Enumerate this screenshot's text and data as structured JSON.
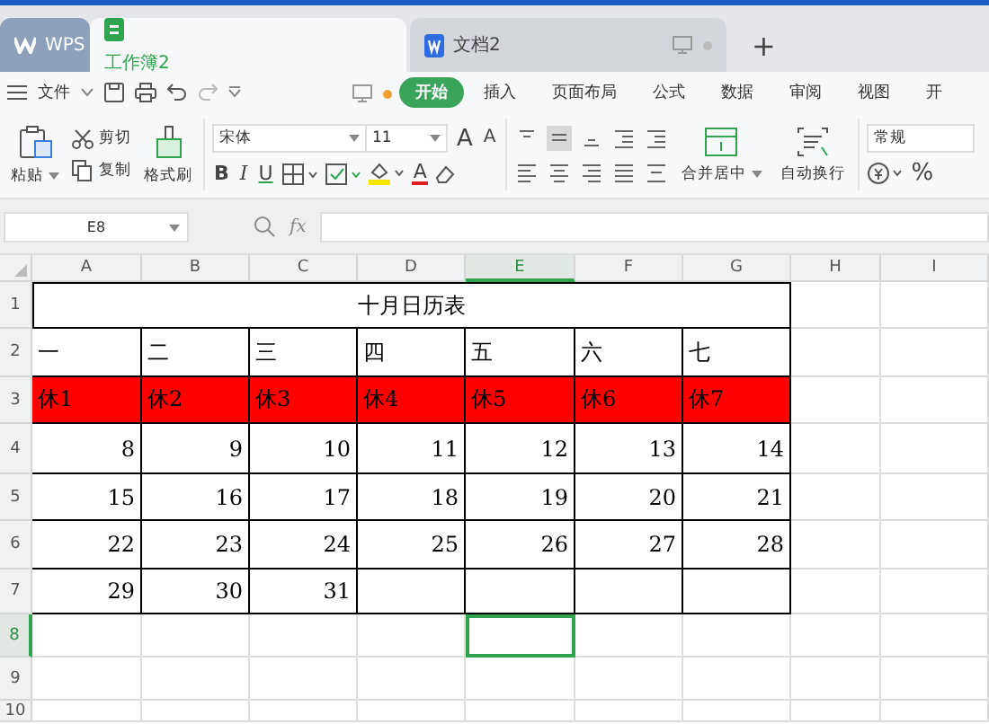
{
  "window_tabs": [
    {
      "label": "WPS",
      "kind": "home",
      "selected": false
    },
    {
      "label": "工作簿2",
      "kind": "sheet",
      "selected": true
    },
    {
      "label": "文档2",
      "kind": "doc",
      "selected": false
    }
  ],
  "new_tab": "+",
  "menu": {
    "label": "文件"
  },
  "ribbon_tabs": [
    {
      "label": "开始",
      "selected": true
    },
    {
      "label": "插入",
      "selected": false
    },
    {
      "label": "页面布局",
      "selected": false
    },
    {
      "label": "公式",
      "selected": false
    },
    {
      "label": "数据",
      "selected": false
    },
    {
      "label": "审阅",
      "selected": false
    },
    {
      "label": "视图",
      "selected": false
    },
    {
      "label": "开",
      "selected": false
    }
  ],
  "clipboard": {
    "paste": "粘贴",
    "cut": "剪切",
    "copy": "复制",
    "format_painter": "格式刷"
  },
  "font": {
    "name": "宋体",
    "size": "11",
    "grow": "A",
    "shrink": "A",
    "bold": "B",
    "italic": "I",
    "underline": "U",
    "font_color": "A"
  },
  "merge": "合并居中",
  "wrap": "自动换行",
  "number_format": "常规",
  "percent": "%",
  "name_box": "E8",
  "fx": "fx",
  "columns": [
    {
      "label": "A",
      "selected": false
    },
    {
      "label": "B",
      "selected": false
    },
    {
      "label": "C",
      "selected": false
    },
    {
      "label": "D",
      "selected": false
    },
    {
      "label": "E",
      "selected": true
    },
    {
      "label": "F",
      "selected": false
    },
    {
      "label": "G",
      "selected": false
    },
    {
      "label": "H",
      "selected": false
    },
    {
      "label": "I",
      "selected": false
    }
  ],
  "rows": [
    {
      "label": "1",
      "selected": false,
      "title": "十月日历表"
    },
    {
      "label": "2",
      "selected": false,
      "cells": [
        "一",
        "二",
        "三",
        "四",
        "五",
        "六",
        "七"
      ]
    },
    {
      "label": "3",
      "selected": false,
      "color": "#ff0000",
      "cells": [
        "休1",
        "休2",
        "休3",
        "休4",
        "休5",
        "休6",
        "休7"
      ]
    },
    {
      "label": "4",
      "selected": false,
      "numeric": true,
      "cells": [
        "8",
        "9",
        "10",
        "11",
        "12",
        "13",
        "14"
      ]
    },
    {
      "label": "5",
      "selected": false,
      "numeric": true,
      "cells": [
        "15",
        "16",
        "17",
        "18",
        "19",
        "20",
        "21"
      ]
    },
    {
      "label": "6",
      "selected": false,
      "numeric": true,
      "cells": [
        "22",
        "23",
        "24",
        "25",
        "26",
        "27",
        "28"
      ]
    },
    {
      "label": "7",
      "selected": false,
      "numeric": true,
      "cells": [
        "29",
        "30",
        "31"
      ]
    },
    {
      "label": "8",
      "selected": true
    },
    {
      "label": "9",
      "selected": false
    },
    {
      "label": "10",
      "selected": false
    }
  ]
}
